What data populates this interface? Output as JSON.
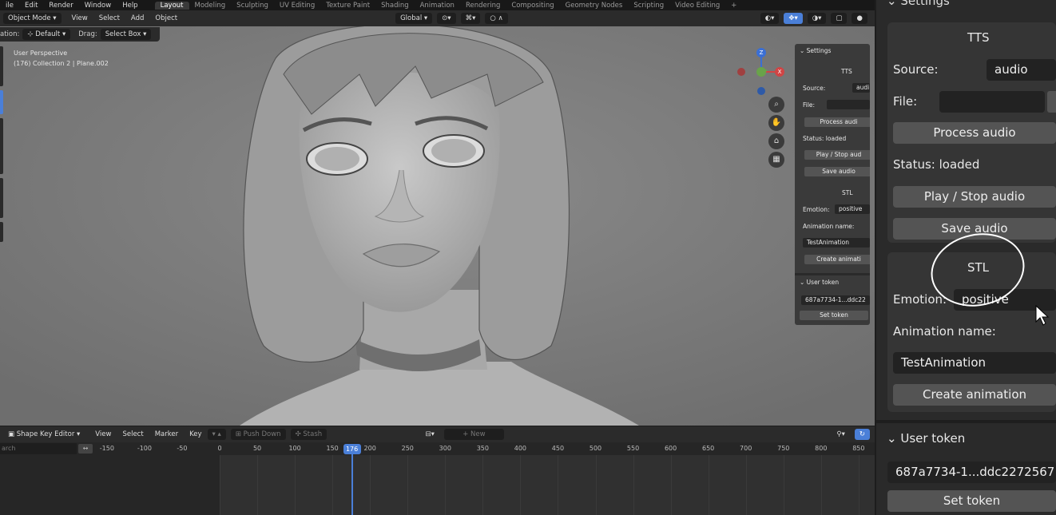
{
  "menu": [
    "ile",
    "Edit",
    "Render",
    "Window",
    "Help"
  ],
  "workspaces": [
    {
      "label": "Layout",
      "active": true
    },
    {
      "label": "Modeling"
    },
    {
      "label": "Sculpting"
    },
    {
      "label": "UV Editing"
    },
    {
      "label": "Texture Paint"
    },
    {
      "label": "Shading"
    },
    {
      "label": "Animation"
    },
    {
      "label": "Rendering"
    },
    {
      "label": "Compositing"
    },
    {
      "label": "Geometry Nodes"
    },
    {
      "label": "Scripting"
    },
    {
      "label": "Video Editing"
    },
    {
      "label": "+"
    }
  ],
  "header": {
    "mode": "Object Mode",
    "view": "View",
    "select": "Select",
    "add": "Add",
    "object": "Object",
    "orientation": "Global"
  },
  "options": {
    "orientation_label": "ation:",
    "orientation_value": "Default",
    "drag_label": "Drag:",
    "drag_value": "Select Box"
  },
  "viewport_info": {
    "line1": "User Perspective",
    "line2": "(176) Collection 2 | Plane.002"
  },
  "gizmo": {
    "z": "Z",
    "x": "X"
  },
  "mini_panel": {
    "title": "Settings",
    "tts": "TTS",
    "source_label": "Source:",
    "source_value": "audi",
    "file_label": "File:",
    "process": "Process audi",
    "status": "Status: loaded",
    "play": "Play / Stop aud",
    "save": "Save audio",
    "stl": "STL",
    "emotion_label": "Emotion:",
    "emotion_value": "positive",
    "anim_label": "Animation name:",
    "anim_value": "TestAnimation",
    "create": "Create animati",
    "user_token": "User token",
    "token_value": "687a7734-1...ddc22",
    "set_token": "Set token"
  },
  "timeline": {
    "editor": "Shape Key Editor",
    "view": "View",
    "select": "Select",
    "marker": "Marker",
    "key": "Key",
    "push_down": "Push Down",
    "stash": "Stash",
    "new": "New",
    "search_placeholder": "arch",
    "current_frame": "176",
    "ticks": [
      "-150",
      "-100",
      "-50",
      "0",
      "50",
      "100",
      "150",
      "200",
      "250",
      "300",
      "350",
      "400",
      "450",
      "500",
      "550",
      "600",
      "650",
      "700",
      "750",
      "800",
      "850"
    ]
  },
  "sidebar": {
    "title": "Settings",
    "tts": "TTS",
    "source_label": "Source:",
    "source_value": "audio",
    "file_label": "File:",
    "process": "Process audio",
    "status": "Status: loaded",
    "play": "Play / Stop audio",
    "save": "Save audio",
    "stl": "STL",
    "emotion_label": "Emotion:",
    "emotion_value": "positive",
    "anim_label": "Animation name:",
    "anim_value": "TestAnimation",
    "create": "Create animation",
    "user_token": "User token",
    "token_value": "687a7734-1...ddc2272567",
    "set_token": "Set token"
  }
}
